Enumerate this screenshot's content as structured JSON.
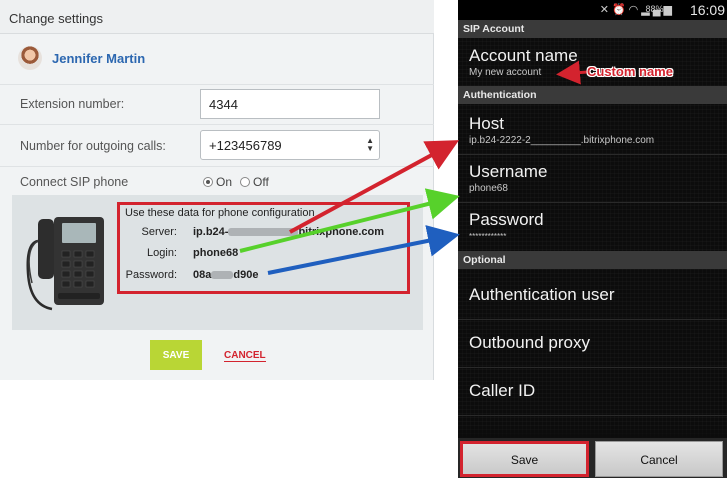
{
  "dialog": {
    "title": "Change settings",
    "user_name": "Jennifer Martin",
    "extension_label": "Extension number:",
    "extension_value": "4344",
    "outgoing_label": "Number for outgoing calls:",
    "outgoing_value": "+123456789",
    "connect_label": "Connect SIP phone",
    "radio_on": "On",
    "radio_off": "Off",
    "config_title": "Use these data for phone configuration",
    "server_key": "Server:",
    "server_val_a": "ip.b24-",
    "server_val_b": "bitrixphone.com",
    "login_key": "Login:",
    "login_val": "phone68",
    "password_key": "Password:",
    "password_val_a": "08a",
    "password_val_b": "d90e",
    "save_label": "SAVE",
    "cancel_label": "CANCEL"
  },
  "android": {
    "clock": "16:09",
    "battery": "88%",
    "section_sip": "SIP Account",
    "account_name_title": "Account name",
    "account_name_value": "My new account",
    "section_auth": "Authentication",
    "host_title": "Host",
    "host_value": "ip.b24-2222-2_________.bitrixphone.com",
    "username_title": "Username",
    "username_value": "phone68",
    "password_title": "Password",
    "password_value": "************",
    "section_optional": "Optional",
    "auth_user_title": "Authentication user",
    "outbound_proxy_title": "Outbound proxy",
    "caller_id_title": "Caller ID",
    "save_label": "Save",
    "cancel_label": "Cancel"
  },
  "annotation": {
    "custom_name": "Custom name"
  },
  "colors": {
    "accent_red": "#d3232e",
    "save_green": "#b9d635",
    "link_blue": "#2c67b0",
    "arrow_green": "#57d12b",
    "arrow_blue": "#1f5fbf"
  },
  "icons": [
    "avatar",
    "ip-phone-icon",
    "mute-icon",
    "alarm-icon",
    "wifi-icon",
    "signal-icon",
    "battery-icon",
    "select-arrows-icon"
  ]
}
